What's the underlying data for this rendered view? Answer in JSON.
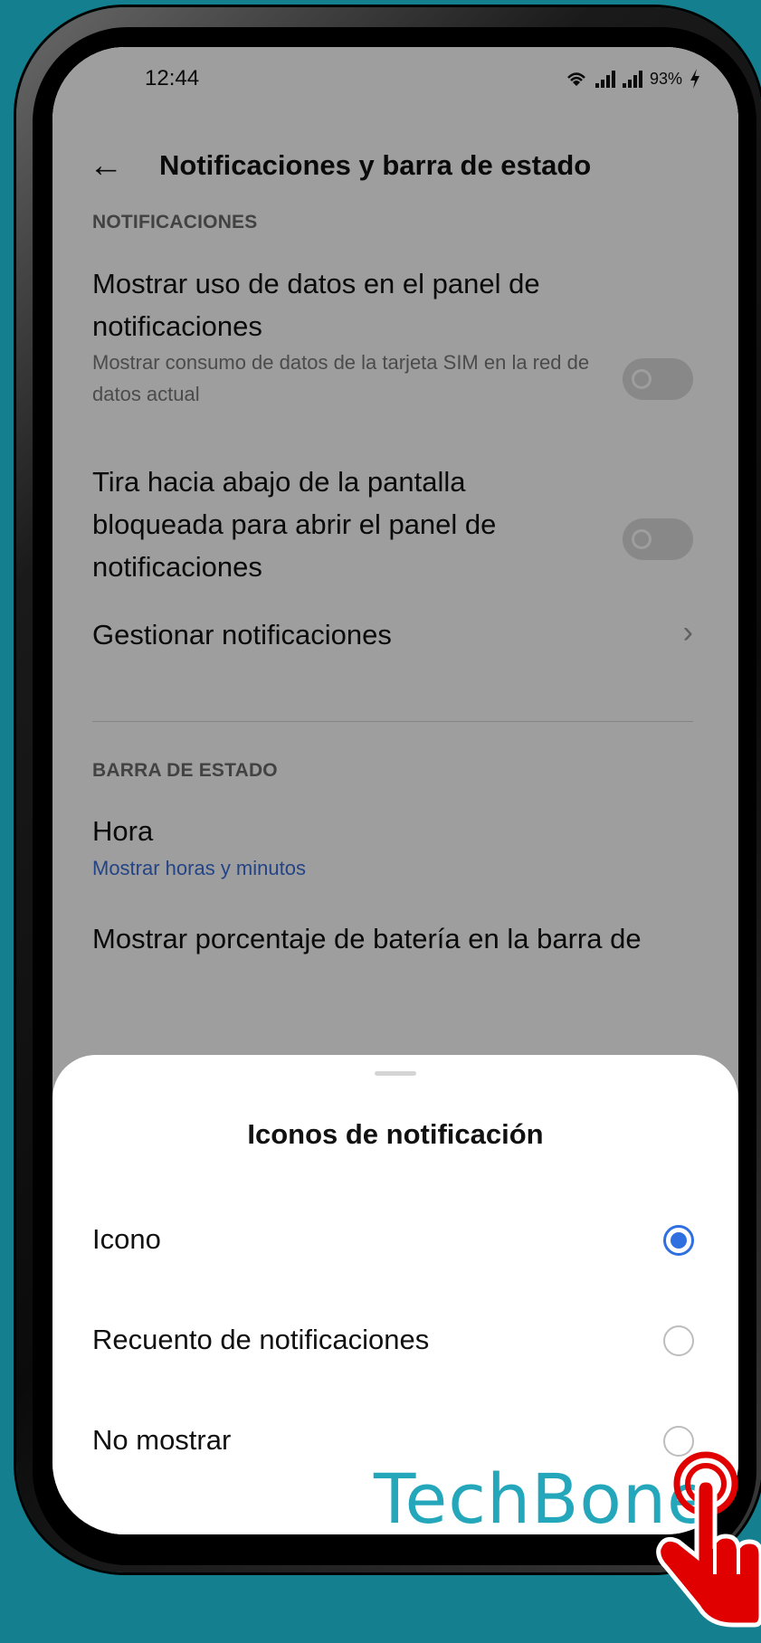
{
  "status_bar": {
    "time": "12:44",
    "battery": "93%"
  },
  "header": {
    "title": "Notificaciones y barra de estado"
  },
  "sections": {
    "notifications_label": "NOTIFICACIONES",
    "status_bar_label": "BARRA DE ESTADO"
  },
  "settings": {
    "data_usage": {
      "title": "Mostrar uso de datos en el panel de notificaciones",
      "subtitle": "Mostrar consumo de datos de la tarjeta SIM en la red de datos actual",
      "enabled": false
    },
    "pull_down": {
      "title": "Tira hacia abajo de la pantalla bloqueada para abrir el panel de notificaciones",
      "enabled": false
    },
    "manage": {
      "title": "Gestionar notificaciones"
    },
    "time": {
      "title": "Hora",
      "value": "Mostrar horas y minutos"
    },
    "battery_percent": {
      "title": "Mostrar porcentaje de batería en la barra de"
    }
  },
  "sheet": {
    "title": "Iconos de notificación",
    "options": [
      {
        "label": "Icono",
        "selected": true
      },
      {
        "label": "Recuento de notificaciones",
        "selected": false
      },
      {
        "label": "No mostrar",
        "selected": false
      }
    ]
  },
  "watermark": "TechBone",
  "colors": {
    "background": "#147f8f",
    "accent": "#2f6fe0",
    "link": "#3b6fd8",
    "watermark": "#1aa3b8",
    "hand": "#e10000"
  }
}
